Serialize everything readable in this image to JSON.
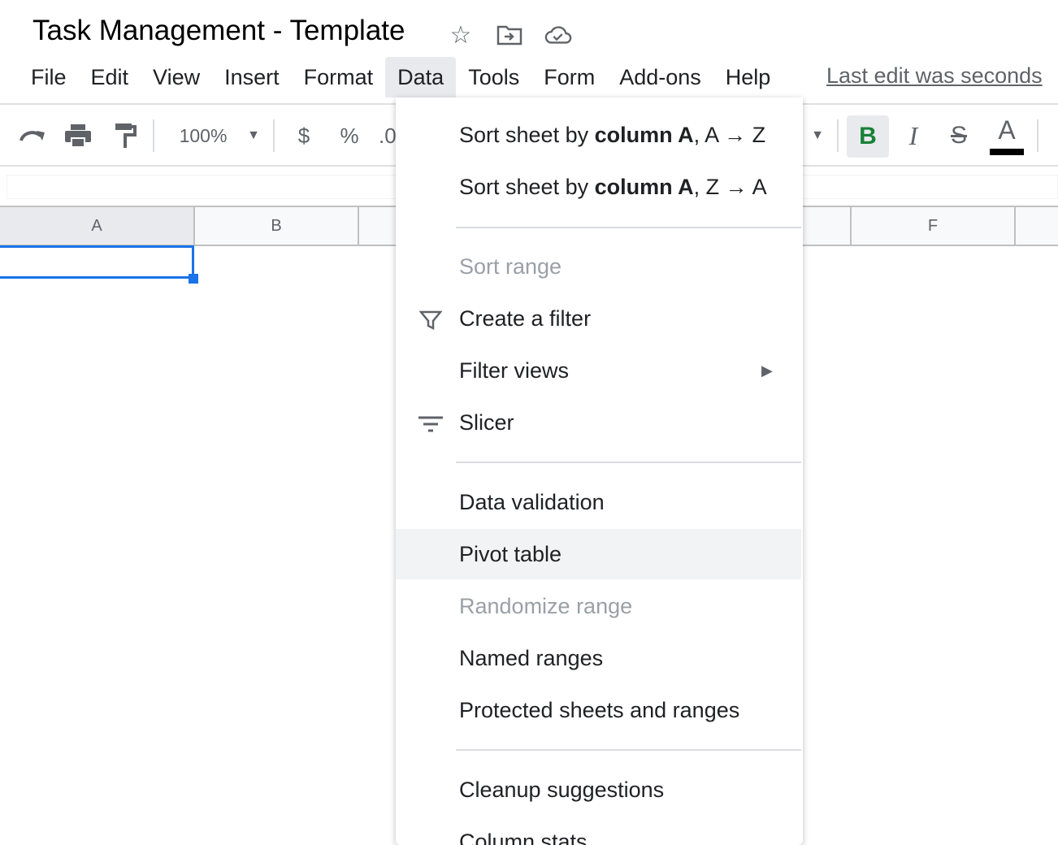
{
  "title": "Task Management - Template",
  "title_icons": [
    "star-icon",
    "move-to-folder-icon",
    "cloud-saved-icon"
  ],
  "menubar": {
    "items": [
      "File",
      "Edit",
      "View",
      "Insert",
      "Format",
      "Data",
      "Tools",
      "Form",
      "Add-ons",
      "Help"
    ],
    "active": "Data",
    "last_edit": "Last edit was seconds"
  },
  "toolbar": {
    "zoom": "100%",
    "currency": "$",
    "percent": "%",
    "decimal": ".0",
    "bold": "B",
    "italic": "I",
    "strike": "S",
    "text_color": "A",
    "bold_color": "#188038",
    "text_color_bar": "#000000"
  },
  "columns": [
    "A",
    "B",
    "F"
  ],
  "data_menu": {
    "items": [
      {
        "pre": "Sort sheet by ",
        "bold": "column A",
        "post": ", A → Z"
      },
      {
        "pre": "Sort sheet by ",
        "bold": "column A",
        "post": ", Z → A"
      },
      {
        "label": "Sort range",
        "disabled": true
      },
      {
        "label": "Create a filter",
        "icon": "filter-icon"
      },
      {
        "label": "Filter views",
        "submenu": true
      },
      {
        "label": "Slicer",
        "icon": "slicer-icon"
      },
      {
        "label": "Data validation"
      },
      {
        "label": "Pivot table",
        "highlighted": true
      },
      {
        "label": "Randomize range",
        "disabled": true
      },
      {
        "label": "Named ranges"
      },
      {
        "label": "Protected sheets and ranges"
      },
      {
        "label": "Cleanup suggestions"
      },
      {
        "label": "Column stats"
      }
    ]
  },
  "colors": {
    "accent": "#1a73e8",
    "hover": "#f1f3f4"
  }
}
